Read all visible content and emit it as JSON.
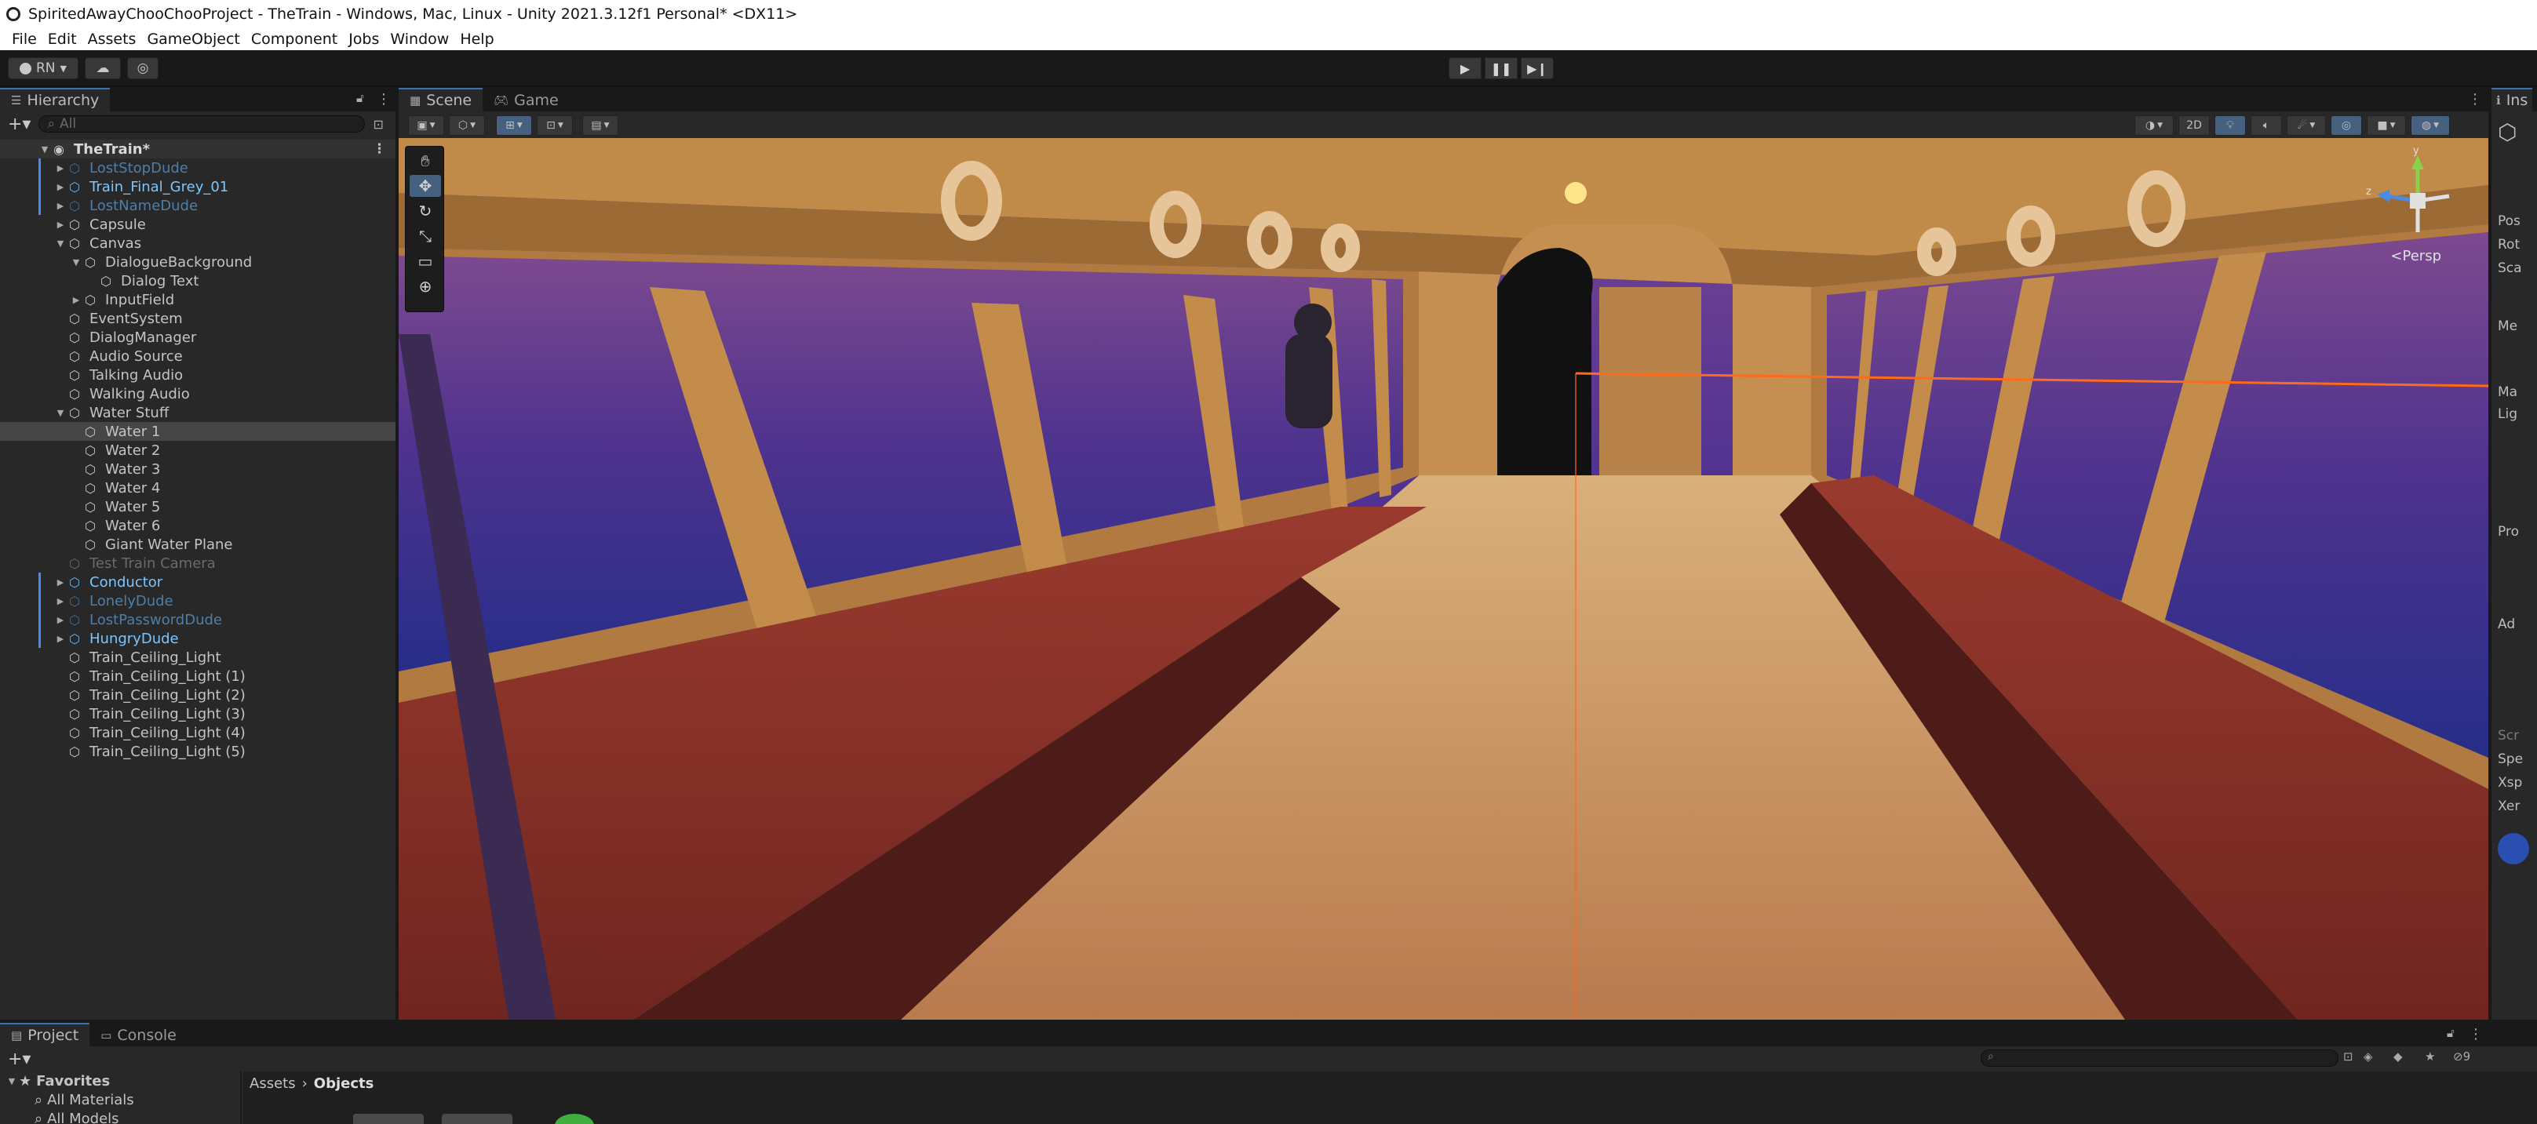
{
  "window": {
    "title": "SpiritedAwayChooChooProject - TheTrain - Windows, Mac, Linux - Unity 2021.3.12f1 Personal* <DX11>"
  },
  "menu": [
    "File",
    "Edit",
    "Assets",
    "GameObject",
    "Component",
    "Jobs",
    "Window",
    "Help"
  ],
  "toolbar": {
    "account_label": "RN",
    "icons": [
      "account-icon",
      "cloud-icon",
      "collab-icon",
      "play-icon",
      "pause-icon",
      "step-icon"
    ]
  },
  "hierarchy": {
    "tab_label": "Hierarchy",
    "search_placeholder": "All",
    "scene_name": "TheTrain*",
    "items": [
      {
        "label": "LostStopDude",
        "kind": "prefab-dim",
        "depth": 1,
        "arrow": "collapsed"
      },
      {
        "label": "Train_Final_Grey_01",
        "kind": "prefab",
        "depth": 1,
        "arrow": "collapsed"
      },
      {
        "label": "LostNameDude",
        "kind": "prefab-dim",
        "depth": 1,
        "arrow": "collapsed"
      },
      {
        "label": "Capsule",
        "kind": "object",
        "depth": 1,
        "arrow": "collapsed"
      },
      {
        "label": "Canvas",
        "kind": "object",
        "depth": 1,
        "arrow": "expanded"
      },
      {
        "label": "DialogueBackground",
        "kind": "object",
        "depth": 2,
        "arrow": "expanded"
      },
      {
        "label": "Dialog Text",
        "kind": "object",
        "depth": 3,
        "arrow": "none"
      },
      {
        "label": "InputField",
        "kind": "object",
        "depth": 2,
        "arrow": "collapsed"
      },
      {
        "label": "EventSystem",
        "kind": "object",
        "depth": 1,
        "arrow": "none"
      },
      {
        "label": "DialogManager",
        "kind": "object",
        "depth": 1,
        "arrow": "none"
      },
      {
        "label": "Audio Source",
        "kind": "object",
        "depth": 1,
        "arrow": "none"
      },
      {
        "label": "Talking Audio",
        "kind": "object",
        "depth": 1,
        "arrow": "none"
      },
      {
        "label": "Walking Audio",
        "kind": "object",
        "depth": 1,
        "arrow": "none"
      },
      {
        "label": "Water Stuff",
        "kind": "object",
        "depth": 1,
        "arrow": "expanded"
      },
      {
        "label": "Water 1",
        "kind": "object",
        "depth": 2,
        "arrow": "none",
        "selected": true
      },
      {
        "label": "Water 2",
        "kind": "object",
        "depth": 2,
        "arrow": "none"
      },
      {
        "label": "Water 3",
        "kind": "object",
        "depth": 2,
        "arrow": "none"
      },
      {
        "label": "Water 4",
        "kind": "object",
        "depth": 2,
        "arrow": "none"
      },
      {
        "label": "Water 5",
        "kind": "object",
        "depth": 2,
        "arrow": "none"
      },
      {
        "label": "Water 6",
        "kind": "object",
        "depth": 2,
        "arrow": "none"
      },
      {
        "label": "Giant Water Plane",
        "kind": "object",
        "depth": 2,
        "arrow": "none"
      },
      {
        "label": "Test Train Camera",
        "kind": "disabled",
        "depth": 1,
        "arrow": "none"
      },
      {
        "label": "Conductor",
        "kind": "prefab",
        "depth": 1,
        "arrow": "collapsed"
      },
      {
        "label": "LonelyDude",
        "kind": "prefab-dim",
        "depth": 1,
        "arrow": "collapsed"
      },
      {
        "label": "LostPasswordDude",
        "kind": "prefab-dim",
        "depth": 1,
        "arrow": "collapsed"
      },
      {
        "label": "HungryDude",
        "kind": "prefab",
        "depth": 1,
        "arrow": "collapsed"
      },
      {
        "label": "Train_Ceiling_Light",
        "kind": "object",
        "depth": 1,
        "arrow": "none"
      },
      {
        "label": "Train_Ceiling_Light (1)",
        "kind": "object",
        "depth": 1,
        "arrow": "none"
      },
      {
        "label": "Train_Ceiling_Light (2)",
        "kind": "object",
        "depth": 1,
        "arrow": "none"
      },
      {
        "label": "Train_Ceiling_Light (3)",
        "kind": "object",
        "depth": 1,
        "arrow": "none"
      },
      {
        "label": "Train_Ceiling_Light (4)",
        "kind": "object",
        "depth": 1,
        "arrow": "none"
      },
      {
        "label": "Train_Ceiling_Light (5)",
        "kind": "object",
        "depth": 1,
        "arrow": "none"
      }
    ]
  },
  "scene_view": {
    "tabs": [
      {
        "label": "Scene",
        "active": true
      },
      {
        "label": "Game",
        "active": false
      }
    ],
    "mode_2d": "2D",
    "camera_label": "<Persp",
    "axis_y": "y",
    "axis_z": "z"
  },
  "inspector": {
    "tab_label": "Ins",
    "rows": [
      "Pos",
      "Rot",
      "Sca",
      "Me",
      "Ma",
      "Lig",
      "Pro",
      "Ad",
      "Scr",
      "Spe",
      "Xsp",
      "Xer"
    ]
  },
  "project": {
    "tabs": [
      {
        "label": "Project",
        "active": true
      },
      {
        "label": "Console",
        "active": false
      }
    ],
    "hidden_count": "9",
    "favorites_label": "Favorites",
    "favorites": [
      "All Materials",
      "All Models"
    ],
    "breadcrumb": [
      "Assets",
      "Objects"
    ]
  },
  "colors": {
    "accent_blue": "#3a72b0",
    "prefab_blue": "#7bc6ff",
    "selection": "#464646",
    "panel_bg": "#282828"
  }
}
